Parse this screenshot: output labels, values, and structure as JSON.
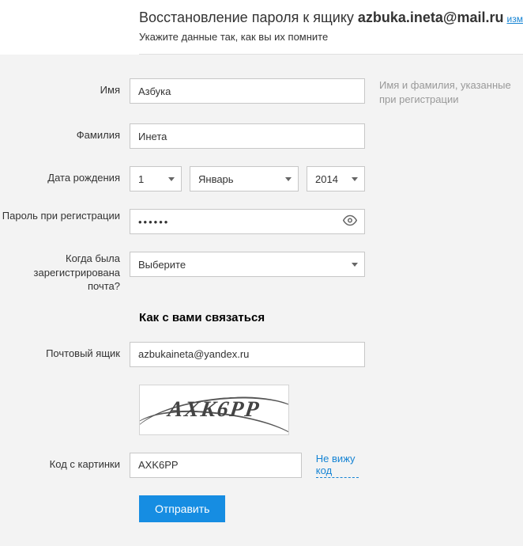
{
  "header": {
    "title_prefix": "Восстановление пароля к ящику ",
    "email": "azbuka.ineta@mail.ru",
    "change_link": "изм",
    "subtitle": "Укажите данные так, как вы их помните"
  },
  "labels": {
    "name": "Имя",
    "surname": "Фамилия",
    "dob": "Дата рождения",
    "password": "Пароль при регистрации",
    "when_registered": "Когда была зарегистрирована почта?",
    "mailbox": "Почтовый ящик",
    "captcha": "Код с картинки"
  },
  "values": {
    "name": "Азбука",
    "surname": "Инета",
    "dob_day": "1",
    "dob_month": "Январь",
    "dob_year": "2014",
    "password": "••••••",
    "when_registered": "Выберите",
    "mailbox": "azbukaineta@yandex.ru",
    "captcha_text": "AXK6PP",
    "captcha_input": "AXK6PP"
  },
  "hints": {
    "name": "Имя и фамилия, указанные при регистрации"
  },
  "section": {
    "contact": "Как с вами связаться"
  },
  "links": {
    "no_code": "Не вижу код"
  },
  "buttons": {
    "submit": "Отправить"
  }
}
